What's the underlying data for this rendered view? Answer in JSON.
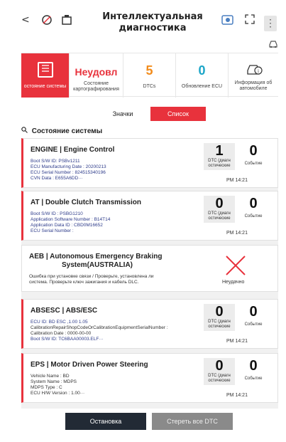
{
  "header": {
    "title_line1": "Интеллектуальная",
    "title_line2": "диагностика",
    "back_glyph": "<",
    "icons": [
      "back-icon",
      "cancel-comm-icon",
      "vci-icon",
      "help-icon",
      "fullscreen-icon",
      "menu-icon",
      "car-icon"
    ],
    "menu_glyph": "⋮"
  },
  "summary": [
    {
      "id": "system-status",
      "value": "",
      "label": "остояние системы",
      "active": true
    },
    {
      "id": "mapping-status",
      "value": "Неудовл",
      "label_1": "Состояние",
      "label_2": "картографирования"
    },
    {
      "id": "dtcs",
      "value": "5",
      "label": "DTCs"
    },
    {
      "id": "ecu-update",
      "value": "0",
      "label": "Обновление ECU"
    },
    {
      "id": "vehicle-info",
      "value": "",
      "label_1": "Информация об",
      "label_2": "автомобиле"
    }
  ],
  "toggle": {
    "icons_label": "Значки",
    "list_label": "Список",
    "selected": "list"
  },
  "section": {
    "title": "Состояние системы"
  },
  "cards": [
    {
      "title": "ENGINE | Engine Control",
      "lines": [
        "Boot S/W ID: PSBv1211",
        "ECU Manufacturing Date : 20200213",
        "ECU Serial Number : 824515340196",
        "CVN Data : E655A6DD···"
      ],
      "dtc": "1",
      "events": "0",
      "time": "PM 14:21"
    },
    {
      "title": "AT | Double Clutch Transmission",
      "lines": [
        "Boot S/W ID : PSBG1210",
        "Application Software Number : B14T14",
        "Application Data ID : CBD0M16652",
        "ECU Serial Number :"
      ],
      "dtc": "0",
      "events": "0",
      "time": "PM 14:21"
    },
    {
      "title_1": "AEB | Autonomous Emergency Braking",
      "title_2": "System(AUSTRALIA)",
      "message_1": "Ошибка при установке связи / Проверьте, установлена ли",
      "message_2": "система. Проверьте ключ зажигания и кабель DLC.",
      "status": "Неудачно"
    },
    {
      "title": "ABSESC | ABS/ESC",
      "lines": [
        "ECU ID: BD ESC ,1.00 1.05",
        "CalibrationRepairShopCodeOrCalibrationEquipmentSerialNumber :",
        "Calibration Date : 0000-00-00",
        "Boot S/W ID: TC6BAA00003.ELF···"
      ],
      "dtc": "0",
      "events": "0",
      "time": "PM 14:21"
    },
    {
      "title": "EPS | Motor Driven Power Steering",
      "lines": [
        "Vehicle Name : BD",
        "System Name : MDPS",
        "MDPS Type : C",
        "ECU H/W Version : 1.00···"
      ],
      "dtc": "0",
      "events": "0",
      "time": "PM 14:21"
    }
  ],
  "counter_labels": {
    "dtc_1": "DTC (диагн",
    "dtc_2": "остические",
    "events": "Событие"
  },
  "buttons": {
    "stop": "Остановка",
    "clear_all": "Стереть все DTC"
  },
  "colors": {
    "accent": "#e8323c",
    "dark_button": "#222a35",
    "disabled_button": "#8a8a8a"
  }
}
